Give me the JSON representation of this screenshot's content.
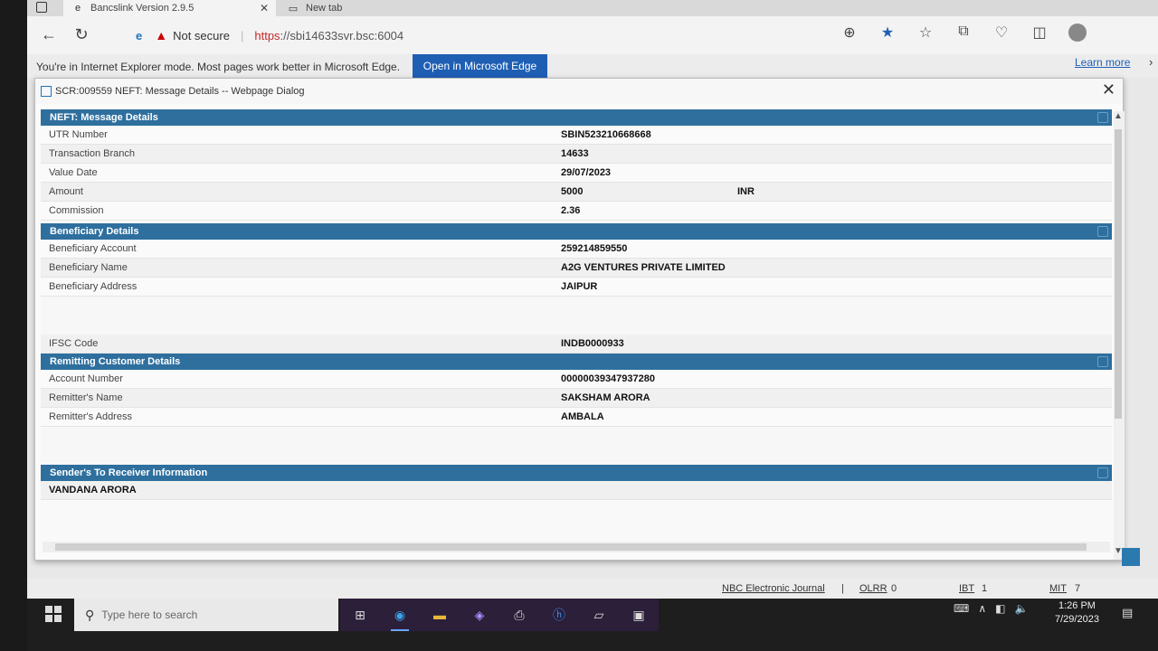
{
  "browser": {
    "tabs": [
      {
        "label": "Bancslink Version 2.9.5",
        "active": true
      },
      {
        "label": "New tab",
        "active": false
      }
    ],
    "tab_close": "✕",
    "security_label": "Not secure",
    "url_scheme": "https",
    "url_rest": "://sbi14633svr.bsc:6004",
    "ie_mode_message": "You're in Internet Explorer mode. Most pages work better in Microsoft Edge.",
    "open_edge_label": "Open in Microsoft Edge",
    "learn_more_label": "Learn more"
  },
  "dialog": {
    "title": "SCR:009559 NEFT: Message Details -- Webpage Dialog",
    "sections": {
      "message": {
        "header": "NEFT: Message Details",
        "rows": [
          {
            "label": "UTR Number",
            "value": "SBIN523210668668"
          },
          {
            "label": "Transaction Branch",
            "value": "14633"
          },
          {
            "label": "Value Date",
            "value": "29/07/2023"
          },
          {
            "label": "Amount",
            "value": "5000",
            "currency": "INR"
          },
          {
            "label": "Commission",
            "value": "2.36"
          }
        ]
      },
      "beneficiary": {
        "header": "Beneficiary Details",
        "rows": [
          {
            "label": "Beneficiary Account",
            "value": "259214859550"
          },
          {
            "label": "Beneficiary Name",
            "value": "A2G VENTURES PRIVATE LIMITED"
          },
          {
            "label": "Beneficiary Address",
            "value": "JAIPUR"
          }
        ],
        "ifsc": {
          "label": "IFSC Code",
          "value": "INDB0000933"
        }
      },
      "remitter": {
        "header": "Remitting Customer Details",
        "rows": [
          {
            "label": "Account Number",
            "value": "00000039347937280"
          },
          {
            "label": "Remitter's Name",
            "value": "SAKSHAM ARORA"
          },
          {
            "label": "Remitter's Address",
            "value": "AMBALA"
          }
        ]
      },
      "sender_info": {
        "header": "Sender's To Receiver Information",
        "text": "VANDANA ARORA"
      }
    }
  },
  "status_bar": {
    "journal": "NBC Electronic Journal",
    "olrr": "OLRR",
    "olrr_count": "0",
    "ibt": "IBT",
    "ibt_count": "1",
    "mit": "MIT",
    "mit_count": "7"
  },
  "taskbar": {
    "search_placeholder": "Type here to search",
    "time": "1:26 PM",
    "date": "7/29/2023"
  }
}
